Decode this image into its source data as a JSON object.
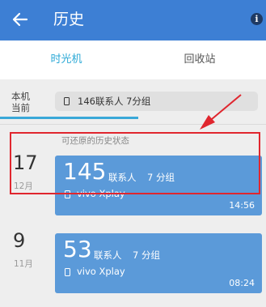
{
  "appbar": {
    "title": "历史",
    "back_icon": "arrow-back-icon",
    "info_icon": "info-icon",
    "info_glyph": "i",
    "color": "#3d7fd4"
  },
  "tabs": [
    {
      "label": "时光机",
      "active": true
    },
    {
      "label": "回收站",
      "active": false
    }
  ],
  "local": {
    "label_line1": "本机",
    "label_line2": "当前",
    "summary": "146联系人  7分组",
    "phone_icon": "phone-icon"
  },
  "hint": "可还原的历史状态",
  "entries": [
    {
      "day": "17",
      "month": "12月",
      "count": "145",
      "contacts_label": "联系人",
      "groups": "7 分组",
      "device": "vivo Xplay",
      "time": "14:56",
      "highlighted": true
    },
    {
      "day": "9",
      "month": "11月",
      "count": "53",
      "contacts_label": "联系人",
      "groups": "7 分组",
      "device": "vivo Xplay",
      "time": "08:24",
      "highlighted": false
    }
  ],
  "colors": {
    "accent": "#2aa8d6",
    "card": "#5b9ad9",
    "highlight": "#e0262e"
  }
}
